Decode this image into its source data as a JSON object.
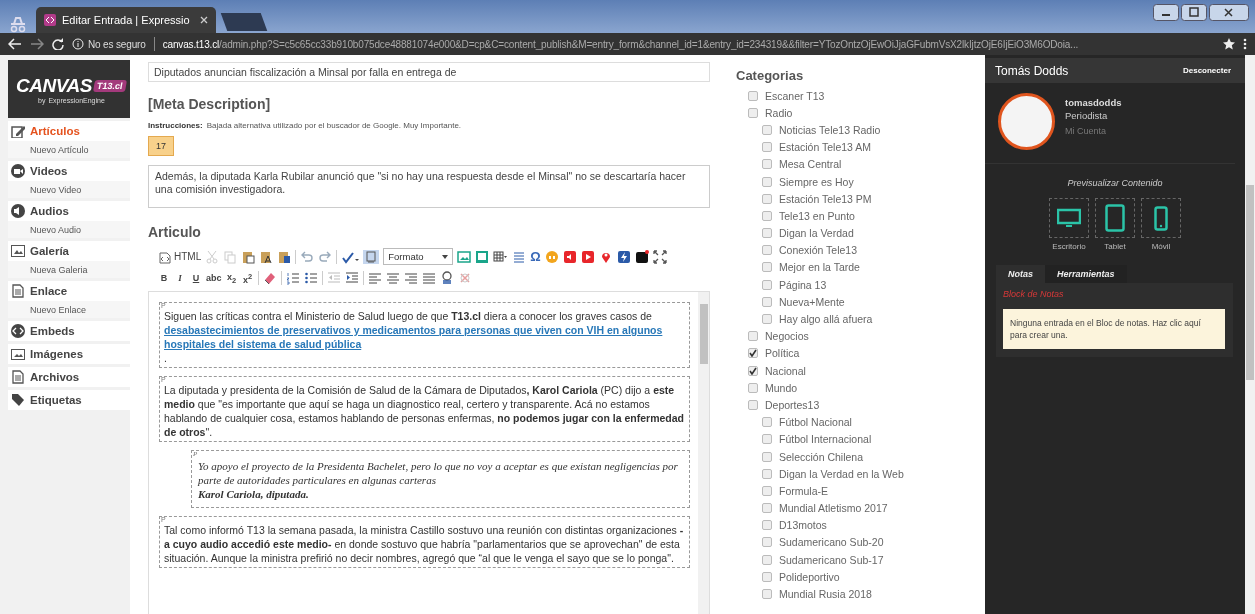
{
  "browser": {
    "tab_title": "Editar Entrada | Expressio",
    "address": {
      "security": "No es seguro",
      "host": "canvas.t13.cl",
      "path": "/admin.php?S=c5c65cc33b910b075dce48881074e000&D=cp&C=content_publish&M=entry_form&channel_id=1&entry_id=234319&&filter=YTozOntzOjEwOiJjaGFubmVsX2lkIjtzOjE6IjEiO3M6ODoia..."
    }
  },
  "sidebar": {
    "logo": {
      "name": "CANVAS",
      "badge": "T13.cl",
      "by": "by",
      "brand": "ExpressionEngine"
    },
    "sections": [
      {
        "kind": "edit",
        "label": "Artículos",
        "selected": true,
        "sub": "Nuevo Artículo"
      },
      {
        "kind": "video",
        "label": "Videos",
        "selected": false,
        "sub": "Nuevo Video"
      },
      {
        "kind": "audio",
        "label": "Audios",
        "selected": false,
        "sub": "Nuevo Audio"
      },
      {
        "kind": "gallery",
        "label": "Galería",
        "selected": false,
        "sub": "Nueva Galeria"
      },
      {
        "kind": "link",
        "label": "Enlace",
        "selected": false,
        "sub": "Nuevo Enlace"
      },
      {
        "kind": "embed",
        "label": "Embeds",
        "selected": false
      },
      {
        "kind": "image",
        "label": "Imágenes",
        "selected": false
      },
      {
        "kind": "file",
        "label": "Archivos",
        "selected": false
      },
      {
        "kind": "tag",
        "label": "Etiquetas",
        "selected": false
      }
    ]
  },
  "main": {
    "title_value": "Diputados anuncian fiscalización a Minsal por falla en entrega de",
    "meta": {
      "heading": "[Meta Description]",
      "instructions_label": "Instrucciones:",
      "instructions": "Bajada alternativa utilizado por el buscador de Google. Muy Importante.",
      "counter": "17",
      "value": "Además, la diputada Karla Rubilar anunció que \"si no hay una respuesta desde el Minsal\" no se descartaría hacer una comisión investigadora."
    },
    "article": {
      "heading": "Articulo",
      "toolbar": {
        "source_label": "HTML",
        "format_label": "Formato",
        "special_char": "Ω",
        "format_buttons": [
          "B",
          "I",
          "U",
          "abc",
          "x$_{2}$",
          "x$^{2}$"
        ]
      },
      "blocks": [
        {
          "kind": "paragraph",
          "marker": "P",
          "segments": [
            {
              "kind": "text",
              "text": "Siguen las críticas contra el Ministerio de Salud luego de que **T13.cl** diera a conocer los graves casos de"
            },
            {
              "kind": "link",
              "text": "desabastecimientos de preservativos y medicamentos para personas que viven con VIH en algunos hospitales del sistema de salud pública"
            },
            {
              "kind": "text",
              "text": "."
            }
          ]
        },
        {
          "kind": "paragraph",
          "marker": "P",
          "segments": [
            {
              "kind": "text",
              "text": "La diputada y presidenta de la Comisión de Salud de la Cámara de Diputados**,** **Karol Cariola** (PC) dijo a **este medio** que \"es importante que aquí se haga un diagnostico real, certero y transparente. Acá no estamos hablando de cualquier cosa, estamos hablando de personas enfermas, **no podemos jugar con la enfermedad de otros**\"."
            }
          ]
        },
        {
          "kind": "quote",
          "marker": "P",
          "text": "Yo apoyo el proyecto de la Presidenta Bachelet, pero lo que no voy a aceptar es que existan negligencias por parte de autoridades particulares en algunas carteras",
          "attribution": "Karol Cariola, diputada."
        },
        {
          "kind": "paragraph",
          "marker": "P",
          "segments": [
            {
              "kind": "text",
              "text": "Tal como informó T13 la semana pasada, la ministra Castillo sostuvo una reunión con distintas organizaciones **-a cuyo audio accedió este medio-** en donde sostuvo que habría \"parlamentarios que se aprovechan\" de esta situación. Aunque la ministra prefirió no decir nombres, agregó que “al que le venga el sayo que se lo ponga\"."
            }
          ]
        }
      ]
    }
  },
  "categories": {
    "title": "Categorias",
    "items": [
      {
        "label": "Escaner T13",
        "checked": false
      },
      {
        "label": "Radio",
        "checked": false,
        "children": [
          {
            "label": "Noticias Tele13 Radio",
            "checked": false
          },
          {
            "label": "Estación Tele13 AM",
            "checked": false
          },
          {
            "label": "Mesa Central",
            "checked": false
          },
          {
            "label": "Siempre es Hoy",
            "checked": false
          },
          {
            "label": "Estación Tele13 PM",
            "checked": false
          },
          {
            "label": "Tele13 en Punto",
            "checked": false
          },
          {
            "label": "Digan la Verdad",
            "checked": false
          },
          {
            "label": "Conexión Tele13",
            "checked": false
          },
          {
            "label": "Mejor en la Tarde",
            "checked": false
          },
          {
            "label": "Página 13",
            "checked": false
          },
          {
            "label": "Nueva+Mente",
            "checked": false
          },
          {
            "label": "Hay algo allá afuera",
            "checked": false
          }
        ]
      },
      {
        "label": "Negocios",
        "checked": false
      },
      {
        "label": "Política",
        "checked": true
      },
      {
        "label": "Nacional",
        "checked": true
      },
      {
        "label": "Mundo",
        "checked": false
      },
      {
        "label": "Deportes13",
        "checked": false,
        "children": [
          {
            "label": "Fútbol Nacional",
            "checked": false
          },
          {
            "label": "Fútbol Internacional",
            "checked": false
          },
          {
            "label": "Selección Chilena",
            "checked": false
          },
          {
            "label": "Digan la Verdad en la Web",
            "checked": false
          },
          {
            "label": "Formula-E",
            "checked": false
          },
          {
            "label": "Mundial Atletismo 2017",
            "checked": false
          },
          {
            "label": "D13motos",
            "checked": false
          },
          {
            "label": "Sudamericano Sub-20",
            "checked": false
          },
          {
            "label": "Sudamericano Sub-17",
            "checked": false
          },
          {
            "label": "Polideportivo",
            "checked": false
          },
          {
            "label": "Mundial Rusia 2018",
            "checked": false
          }
        ]
      }
    ]
  },
  "right_panel": {
    "user_name": "Tomás Dodds",
    "logout": "Desconecter",
    "username": "tomasdodds",
    "role": "Periodista",
    "account_link": "Mi Cuenta",
    "preview_title": "Previsualizar Contenido",
    "previews": [
      {
        "kind": "desktop",
        "label": "Escritorio"
      },
      {
        "kind": "tablet",
        "label": "Tablet"
      },
      {
        "kind": "mobile",
        "label": "Móvil"
      }
    ],
    "tabs": [
      {
        "label": "Notas",
        "selected": true
      },
      {
        "label": "Herramientas",
        "selected": false
      }
    ],
    "notes_title": "Block de Notas",
    "notes_empty": "Ninguna entrada en el Bloc de notas. Haz clic aquí para crear una."
  }
}
